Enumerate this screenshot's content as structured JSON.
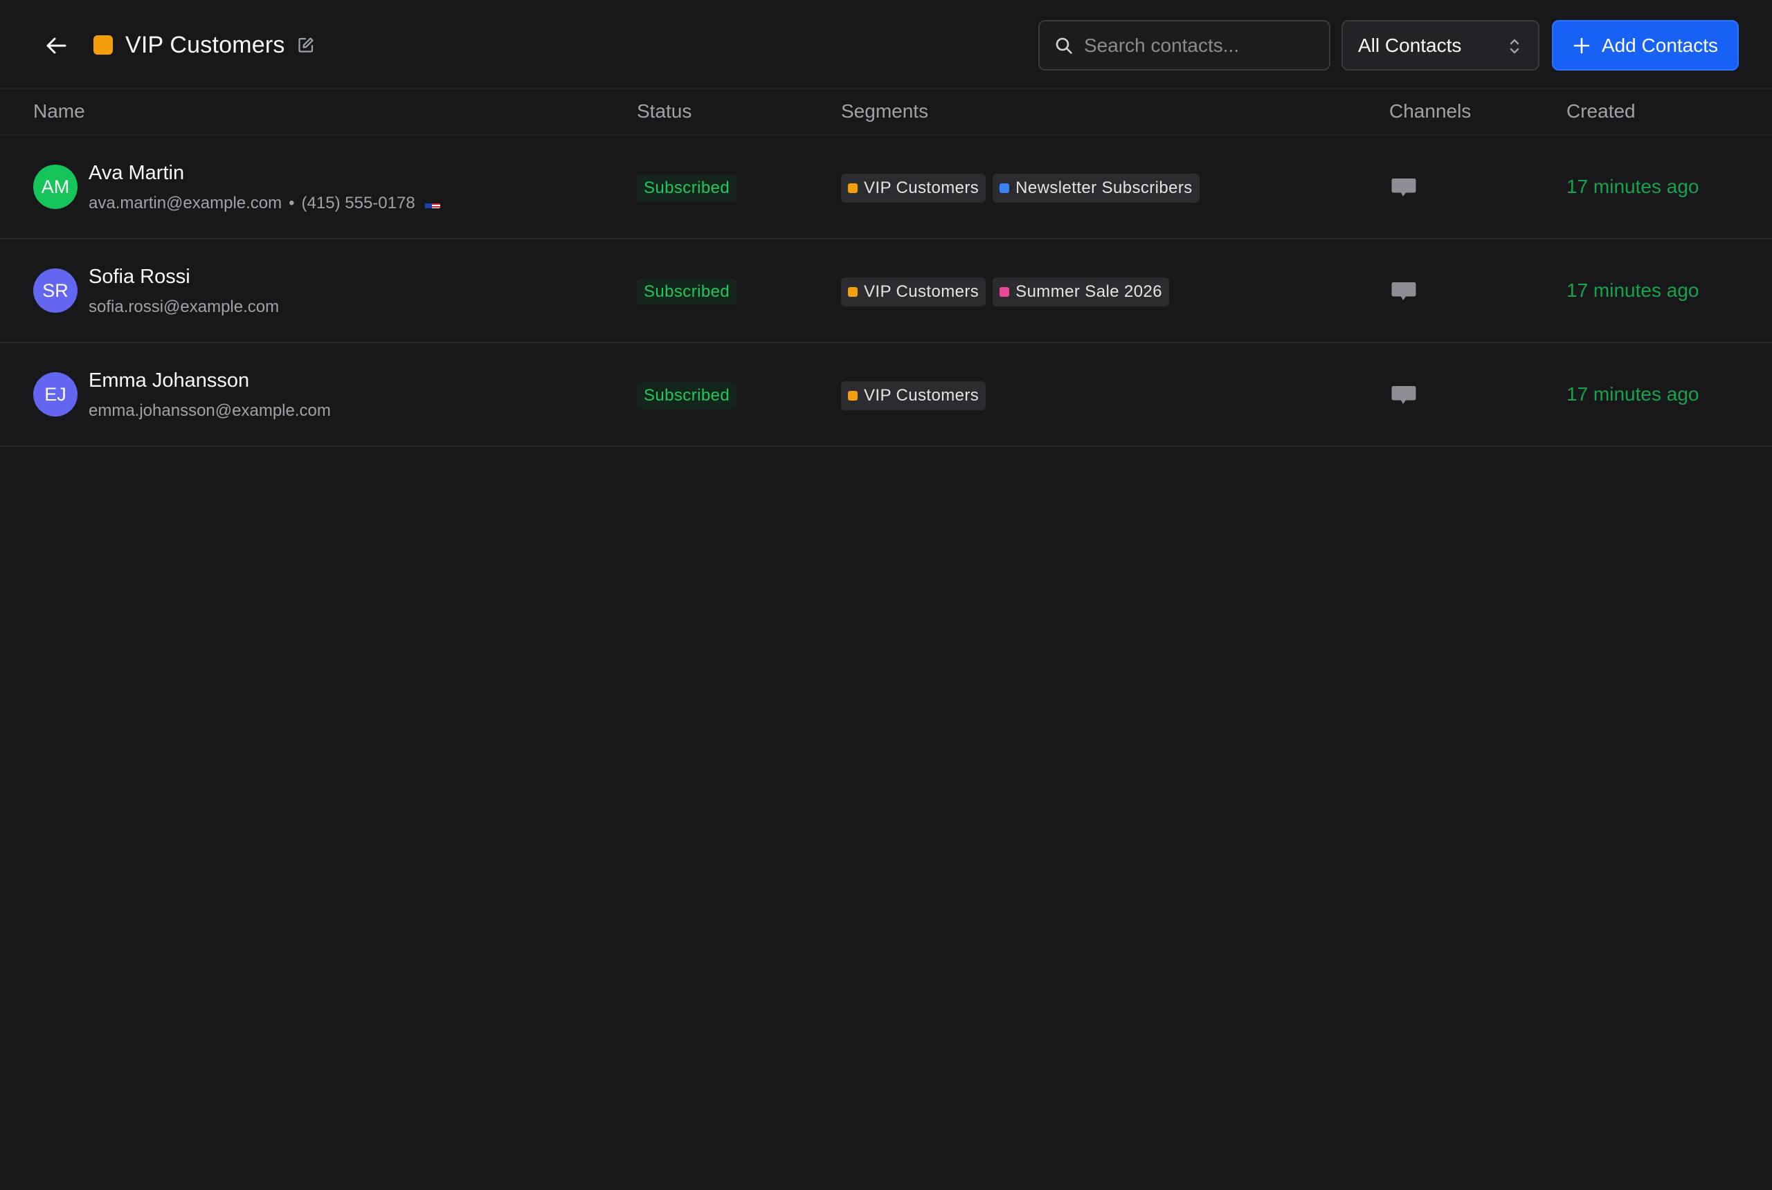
{
  "header": {
    "title": "VIP Customers",
    "title_color": "#f59e0b",
    "search": {
      "placeholder": "Search contacts...",
      "value": ""
    },
    "filter": {
      "selected": "All Contacts"
    },
    "add_button": {
      "label": "Add Contacts"
    }
  },
  "table": {
    "columns": {
      "name": "Name",
      "status": "Status",
      "segments": "Segments",
      "channels": "Channels",
      "created": "Created"
    },
    "rows": [
      {
        "initials": "AM",
        "avatar_color": "#16c559",
        "name": "Ava Martin",
        "email": "ava.martin@example.com",
        "separator": "•",
        "phone": "(415) 555-0178",
        "flag_icon": "us-flag-icon",
        "status": "Subscribed",
        "segments": [
          {
            "label": "VIP Customers",
            "color": "#f59e0b"
          },
          {
            "label": "Newsletter Subscribers",
            "color": "#3b82f6"
          }
        ],
        "channel_icon": "chat-bubble-icon",
        "created": "17 minutes ago"
      },
      {
        "initials": "SR",
        "avatar_color": "#6366f1",
        "name": "Sofia Rossi",
        "email": "sofia.rossi@example.com",
        "status": "Subscribed",
        "segments": [
          {
            "label": "VIP Customers",
            "color": "#f59e0b"
          },
          {
            "label": "Summer Sale 2026",
            "color": "#ec4899"
          }
        ],
        "channel_icon": "chat-bubble-icon",
        "created": "17 minutes ago"
      },
      {
        "initials": "EJ",
        "avatar_color": "#6366f1",
        "name": "Emma Johansson",
        "email": "emma.johansson@example.com",
        "status": "Subscribed",
        "segments": [
          {
            "label": "VIP Customers",
            "color": "#f59e0b"
          }
        ],
        "channel_icon": "chat-bubble-icon",
        "created": "17 minutes ago"
      }
    ]
  }
}
